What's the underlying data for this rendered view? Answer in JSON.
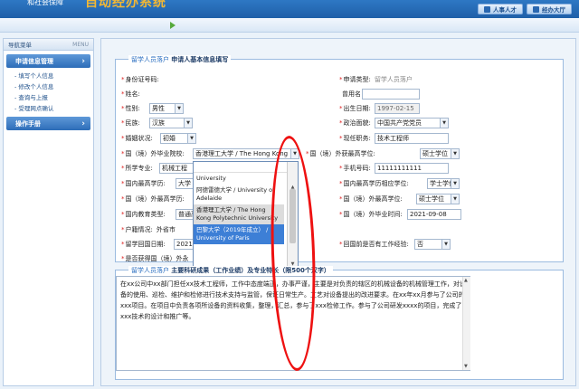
{
  "header": {
    "org": "和社会保障",
    "system_name": "自动经办系统",
    "nav": [
      "人事人才",
      "经办大厅"
    ]
  },
  "sidebar": {
    "title": "导航菜单",
    "menu_label": "MENU",
    "sections": [
      {
        "label": "申请信息管理",
        "items": [
          "- 填写个人信息",
          "- 修改个人信息",
          "- 查询与上报",
          "- 受理网点确认"
        ]
      },
      {
        "label": "操作手册",
        "items": []
      }
    ]
  },
  "form": {
    "legend_prefix": "留学人员落户",
    "legend_title": "申请人基本信息填写",
    "fields": {
      "id_number": {
        "label": "身份证号码:",
        "value": ""
      },
      "apply_type": {
        "label": "申请类型:",
        "value": "留学人员落户"
      },
      "name": {
        "label": "姓名:",
        "value": ""
      },
      "former_name": {
        "label": "曾用名",
        "value": ""
      },
      "gender": {
        "label": "性别:",
        "value": "男性"
      },
      "birth_date": {
        "label": "出生日期:",
        "value": "1997-02-15"
      },
      "ethnicity": {
        "label": "民族:",
        "value": "汉族"
      },
      "political": {
        "label": "政治面貌:",
        "value": "中国共产党党员"
      },
      "marital": {
        "label": "婚姻状况:",
        "value": "初婚"
      },
      "job_title": {
        "label": "现任职务:",
        "value": "技术工程师"
      },
      "foreign_school": {
        "label": "国（境）外毕业院校:",
        "value": "香港理工大学 / The Hong Kong Polytechnic University"
      },
      "foreign_degree": {
        "label": "国（境）外获最高学位:",
        "value": "硕士学位"
      },
      "major": {
        "label": "所学专业:",
        "value": "机械工程"
      },
      "phone": {
        "label": "手机号码:",
        "value": "11111111111"
      },
      "domestic_edu": {
        "label": "国内最高学历:",
        "value": "大学"
      },
      "domestic_degree": {
        "label": "国内最高学历相应学位:",
        "value": "学士学位"
      },
      "foreign_edu": {
        "label": "国（境）外最高学历:",
        "value": "研究生"
      },
      "foreign_degree2": {
        "label": "国（境）外最高学位:",
        "value": "硕士学位"
      },
      "domestic_type": {
        "label": "国内教育类型:",
        "value": "普通高"
      },
      "grad_time": {
        "label": "国（境）外毕业时间:",
        "value": "2021-09-08"
      },
      "hukou": {
        "label": "户籍情况:",
        "value": "外省市"
      },
      "return_date": {
        "label": "留学回国日期:",
        "value": "2021-"
      },
      "work_exp": {
        "label": "回国前是否有工作经验:",
        "value": "否"
      },
      "other": {
        "label": "是否获得国（境）外永",
        "value": ""
      }
    },
    "dropdown_options": [
      "University",
      "阿德雷德大学 / University of Adelaide",
      "香港理工大学 / The Hong Kong Polytechnic University",
      "巴黎大学（2019年成立） / University of Paris"
    ]
  },
  "achievements": {
    "legend_prefix": "留学人员落户",
    "legend_title": "主要科研成果（工作业绩）及专业特长（限500个汉字）",
    "text": "在xx公司中xx部门担任xx技术工程师，工作中态度端正，办事严谨，主要是对负责的辖区的机械设备的机械管理工作，对设备的使用、巡检、维护和检修进行技术支持与监管，保证日常生产。工艺对设备提出的改进要求。在xx年xx月参与了公司的xxx项目。在项目中负责各项所设备的资料收集，整理，汇总，参与了xxx检修工作。参与了公司研发xxxx的项目，完成了xxx技术的设计和推广等。"
  }
}
